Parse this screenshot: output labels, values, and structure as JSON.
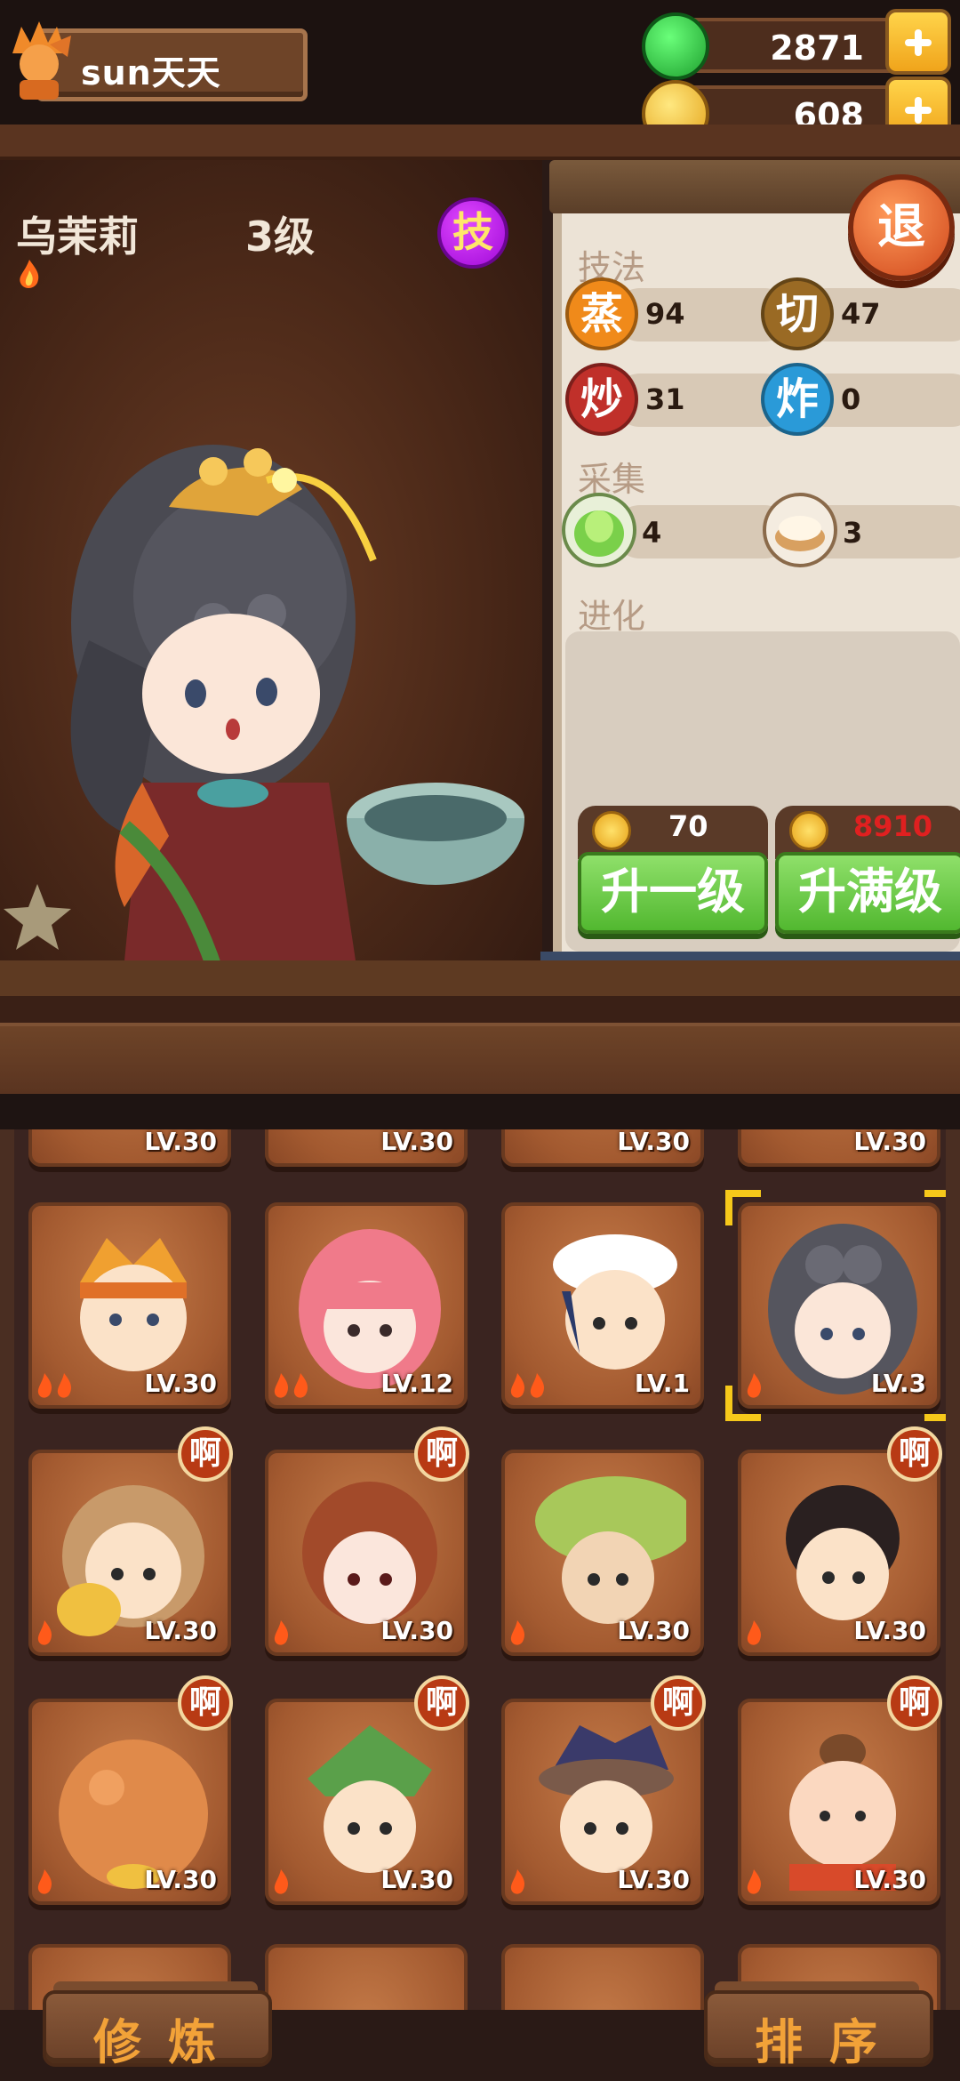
{
  "player": {
    "name": "sun天天"
  },
  "resources": {
    "jade": "2871",
    "coins": "608"
  },
  "character": {
    "name": "乌茉莉",
    "level_text": "3级",
    "skill_button": "技"
  },
  "stage": {
    "favorite_label": "收藏"
  },
  "panel": {
    "exit_label": "退",
    "technique_title": "技法",
    "skills": [
      {
        "glyph": "蒸",
        "value": "94",
        "color": "#f08a1a"
      },
      {
        "glyph": "切",
        "value": "47",
        "color": "#9a6a24"
      },
      {
        "glyph": "炒",
        "value": "31",
        "color": "#c0302a"
      },
      {
        "glyph": "炸",
        "value": "0",
        "color": "#2a9ad8"
      }
    ],
    "gather_title": "采集",
    "gather": [
      {
        "icon": "cabbage-icon",
        "value": "4"
      },
      {
        "icon": "flour-icon",
        "value": "3"
      }
    ],
    "evolve_title": "进化",
    "upgrade_one": {
      "label": "升一级",
      "cost": "70",
      "cost_color": "#ffffff"
    },
    "upgrade_max": {
      "label": "升满级",
      "cost": "8910",
      "cost_color": "#e02020"
    }
  },
  "roster": {
    "row0": [
      "LV.30",
      "LV.30",
      "LV.30",
      "LV.30"
    ],
    "row1": [
      {
        "level": "LV.30",
        "badge": ""
      },
      {
        "level": "LV.12",
        "badge": ""
      },
      {
        "level": "LV.1",
        "badge": ""
      },
      {
        "level": "LV.3",
        "badge": "",
        "selected": true
      }
    ],
    "row2": [
      {
        "level": "LV.30",
        "badge": "啊"
      },
      {
        "level": "LV.30",
        "badge": "啊"
      },
      {
        "level": "LV.30",
        "badge": ""
      },
      {
        "level": "LV.30",
        "badge": "啊"
      }
    ],
    "row3": [
      {
        "level": "LV.30",
        "badge": "啊"
      },
      {
        "level": "LV.30",
        "badge": "啊"
      },
      {
        "level": "LV.30",
        "badge": "啊"
      },
      {
        "level": "LV.30",
        "badge": "啊"
      }
    ]
  },
  "bottom": {
    "train_label": "修炼",
    "sort_label": "排序"
  },
  "colors": {
    "accent_gold": "#f6c81a",
    "green_button": "#52b830",
    "wood": "#6e4428"
  }
}
